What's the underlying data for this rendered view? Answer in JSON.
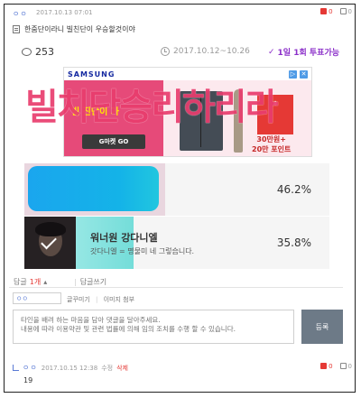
{
  "post": {
    "user": "ㅇㅇ",
    "date": "2017.10.13 07:01",
    "up_count": "0",
    "down_count": "0",
    "title": "한줌단이라니 빌친단이 우승할것이야"
  },
  "poll": {
    "comment_count": "253",
    "period": "2017.10.12~10.26",
    "vote_limit": "1일 1회 투표가능",
    "options": [
      {
        "title": "",
        "desc": "",
        "percent": "46.2%",
        "fill": 0.462,
        "selected": false
      },
      {
        "title": "워너원 강다니엘",
        "desc": "갓다니엘 = 명물미 네 그렇습니다.",
        "percent": "35.8%",
        "fill": 0.358,
        "selected": true
      }
    ]
  },
  "ad": {
    "brand": "SAMSUNG",
    "headline": "빌 진단이 가",
    "cta": "G마켓 GO",
    "points_1": "30만원+",
    "points_2": "20만 포인트"
  },
  "overlay_text": "빌치단승리하리라",
  "comments": {
    "count_label": "답글",
    "count": "1개",
    "write_label": "답글쓰기",
    "nickname": "ㅇㅇ",
    "emoticon": "글꾸미기",
    "image_attach": "이미지 첨부",
    "placeholder": "타인을 배려 하는 마음을 담아 댓글을 달아주세요.\n내용에 따라 이용약관 및 관련 법률에 의해 임의 조치를 수행 할 수 있습니다.",
    "submit_label": "등록"
  },
  "reply": {
    "user": "ㅇㅇ",
    "date": "2017.10.15 12:38",
    "edit": "수정",
    "delete": "삭제",
    "up_count": "0",
    "down_count": "0",
    "text": "19"
  },
  "colors": {
    "accent": "#8b2fc9",
    "overlay": "#e93d6e",
    "bar1": "#e9d6df",
    "bar2": "#74ddd9",
    "submit": "#6d7a87"
  }
}
